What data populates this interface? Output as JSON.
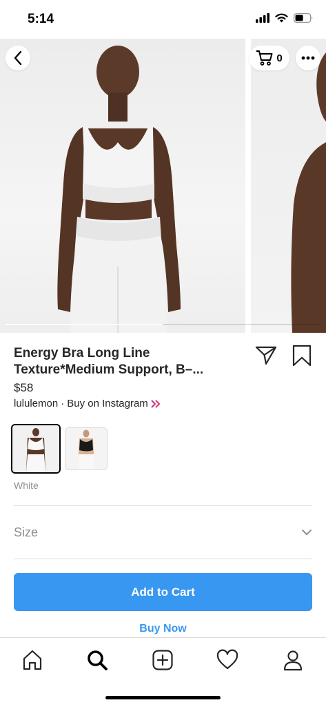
{
  "status_bar": {
    "time": "5:14"
  },
  "header": {
    "cart_count": "0"
  },
  "gallery": {
    "current_index": 1,
    "total": 2
  },
  "product": {
    "title": "Energy Bra Long Line Texture*Medium Support, B–...",
    "price": "$58",
    "seller": "lululemon",
    "separator": "·",
    "buy_source": "Buy on Instagram"
  },
  "variants": {
    "selected_label": "White",
    "options": [
      {
        "color": "White",
        "selected": true
      },
      {
        "color": "Black",
        "selected": false
      }
    ]
  },
  "size": {
    "label": "Size"
  },
  "actions": {
    "add_to_cart": "Add to Cart",
    "buy_now": "Buy Now"
  },
  "colors": {
    "accent": "#3897f0",
    "brand_gradient": "#c13584",
    "text": "#262626",
    "muted": "#8e8e8e",
    "divider": "#dbdbdb"
  },
  "tab_bar": {
    "icons": [
      "home-icon",
      "search-icon",
      "create-post-icon",
      "activity-heart-icon",
      "profile-icon"
    ],
    "active": "search-icon"
  }
}
